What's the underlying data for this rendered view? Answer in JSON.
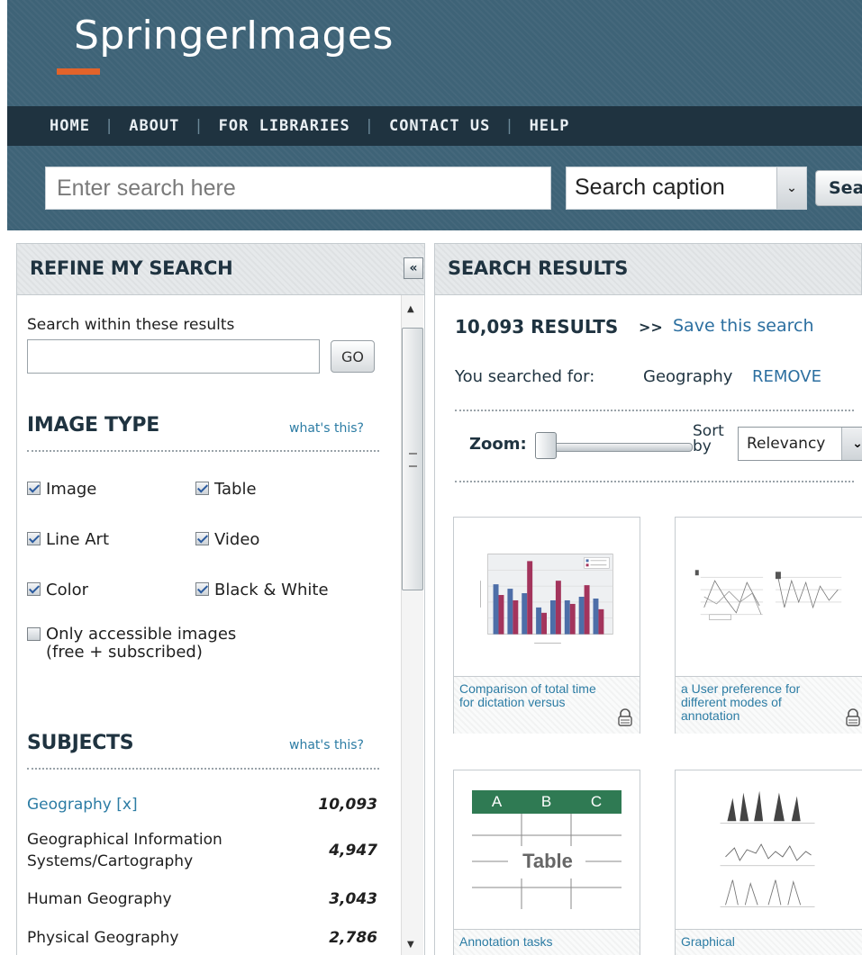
{
  "header": {
    "logo": "SpringerImages",
    "nav": [
      "HOME",
      "ABOUT",
      "FOR LIBRARIES",
      "CONTACT US",
      "HELP"
    ],
    "nav_separator": "|",
    "search_placeholder": "Enter search here",
    "search_scope": "Search caption",
    "search_button": "Sea"
  },
  "refine": {
    "title": "REFINE MY SEARCH",
    "collapse": "«",
    "within_label": "Search within these results",
    "go_label": "GO",
    "image_type": {
      "title": "IMAGE TYPE",
      "whats_this": "what's this?",
      "options": [
        {
          "label": "Image",
          "checked": true
        },
        {
          "label": "Table",
          "checked": true
        },
        {
          "label": "Line Art",
          "checked": true
        },
        {
          "label": "Video",
          "checked": true
        },
        {
          "label": "Color",
          "checked": true
        },
        {
          "label": "Black & White",
          "checked": true
        }
      ],
      "accessible_line1": "Only accessible images",
      "accessible_line2": "(free + subscribed)",
      "accessible_checked": false
    },
    "subjects": {
      "title": "SUBJECTS",
      "whats_this": "what's this?",
      "items": [
        {
          "name": "Geography [x]",
          "count": "10,093",
          "link": true
        },
        {
          "name_line1": "Geographical Information",
          "name_line2": "Systems/Cartography",
          "count": "4,947"
        },
        {
          "name": "Human Geography",
          "count": "3,043"
        },
        {
          "name": "Physical Geography",
          "count": "2,786"
        }
      ]
    }
  },
  "results": {
    "title": "SEARCH RESULTS",
    "count": "10,093 RESULTS",
    "arrows": ">>",
    "save_search": "Save this search",
    "searched_label": "You searched for:",
    "searched_term": "Geography",
    "remove": "REMOVE",
    "zoom_label": "Zoom:",
    "zoom_level": 0.0,
    "sort_label": "Sort by",
    "sort_value": "Relevancy",
    "thumbnails": [
      {
        "caption": "Comparison of total time for dictation versus",
        "locked": true,
        "kind": "bar-chart"
      },
      {
        "caption": "a User preference for different modes of annotation",
        "locked": true,
        "kind": "line-chart"
      },
      {
        "caption": "Annotation tasks",
        "locked": false,
        "kind": "table",
        "table_headers": [
          "A",
          "B",
          "C"
        ],
        "table_label": "Table"
      },
      {
        "caption": "Graphical",
        "locked": false,
        "kind": "signal-plot"
      }
    ]
  },
  "colors": {
    "header_bg": "#3e6377",
    "nav_bg": "#1f3340",
    "accent": "#e2632a",
    "link": "#2c7ca4"
  }
}
